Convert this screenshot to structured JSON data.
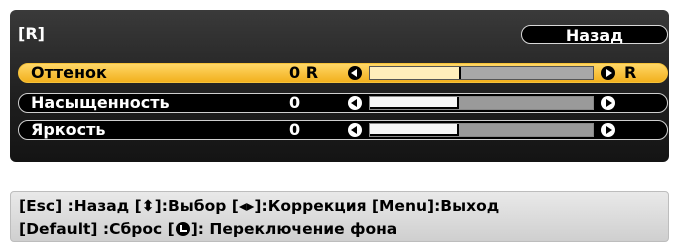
{
  "header": {
    "menu_title": "[R]",
    "back_label": "Назад"
  },
  "rows": [
    {
      "label": "Оттенок",
      "value": "0 R",
      "right_label": "R",
      "level": 0.4,
      "selected": true
    },
    {
      "label": "Насыщенность",
      "value": "0",
      "right_label": "",
      "level": 0.4,
      "selected": false
    },
    {
      "label": "Яркость",
      "value": "0",
      "right_label": "",
      "level": 0.4,
      "selected": false
    }
  ],
  "help": {
    "line1": {
      "part1": "[Esc] :Назад  [",
      "part2": "]:Выбор  [",
      "part3": "]:Коррекция [Menu]:Выход"
    },
    "line2": {
      "part1": "[Default] :Сброс   [",
      "part2": "]: Переключение фона"
    },
    "icons": [
      "up-down-icon",
      "left-right-icon",
      "enter-icon"
    ]
  },
  "colors": {
    "panel_bg": "#1e1e1e",
    "highlight": "#f6c23a"
  }
}
